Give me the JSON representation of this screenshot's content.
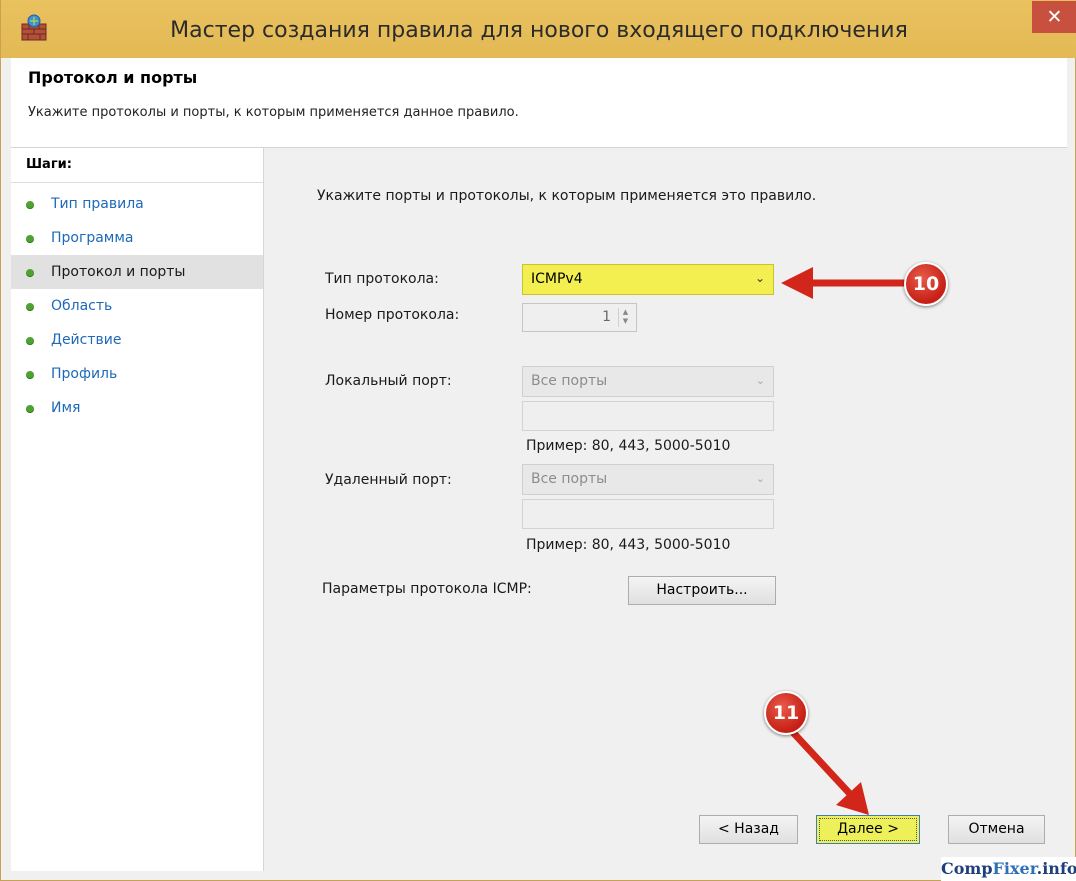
{
  "window": {
    "title": "Мастер создания правила для нового входящего подключения",
    "close_glyph": "✕"
  },
  "header": {
    "title": "Протокол и порты",
    "description": "Укажите протоколы и порты, к которым применяется данное правило."
  },
  "steps": {
    "heading": "Шаги:",
    "items": [
      {
        "label": "Тип правила",
        "active": false
      },
      {
        "label": "Программа",
        "active": false
      },
      {
        "label": "Протокол и порты",
        "active": true
      },
      {
        "label": "Область",
        "active": false
      },
      {
        "label": "Действие",
        "active": false
      },
      {
        "label": "Профиль",
        "active": false
      },
      {
        "label": "Имя",
        "active": false
      }
    ]
  },
  "form": {
    "intro": "Укажите порты и протоколы, к которым применяется это правило.",
    "protocol_type": {
      "label": "Тип протокола:",
      "value": "ICMPv4"
    },
    "protocol_number": {
      "label": "Номер протокола:",
      "value": "1"
    },
    "local_port": {
      "label": "Локальный порт:",
      "value": "Все порты",
      "example": "Пример: 80, 443, 5000-5010"
    },
    "remote_port": {
      "label": "Удаленный порт:",
      "value": "Все порты",
      "example": "Пример: 80, 443, 5000-5010"
    },
    "icmp": {
      "label": "Параметры протокола ICMP:",
      "button": "Настроить..."
    }
  },
  "buttons": {
    "back": "< Назад",
    "next": "Далее >",
    "cancel": "Отмена"
  },
  "annotations": {
    "badge_1": "10",
    "badge_2": "11",
    "color": "#d3261b"
  },
  "watermark": {
    "part1": "Comp",
    "part2": "Fixer",
    "part3": ".info"
  },
  "colors": {
    "titlebar": "#e6bd59",
    "highlight": "#f3ef50",
    "step_dot": "#4fa133",
    "step_link": "#1e69b8"
  }
}
